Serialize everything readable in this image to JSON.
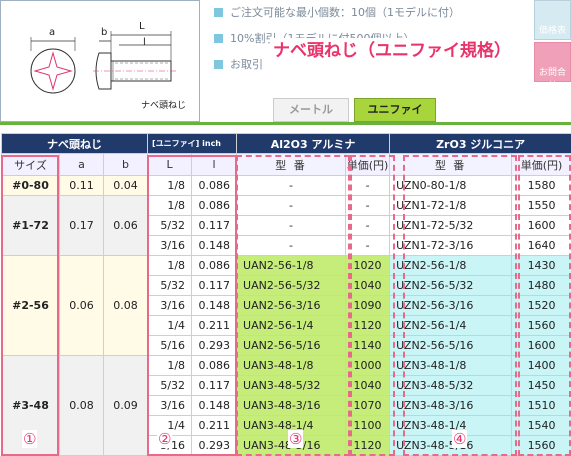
{
  "diagram": {
    "dim_a": "a",
    "dim_b": "b",
    "dim_L": "L",
    "dim_l": "l",
    "caption": "ナベ頭ねじ"
  },
  "info": {
    "item1": "ご注文可能な最小個数：10個（1モデルに付）",
    "item2": "10%割引（1モデルに付500個以上）",
    "item3": "お取引",
    "overlay": "ナベ頭ねじ（ユニファイ規格）"
  },
  "side_buttons": {
    "btn1": "価格表",
    "btn2": "お問合せ"
  },
  "tabs": {
    "metric": "メートル",
    "unify": "ユニファイ"
  },
  "table": {
    "header_left": "ナベ頭ねじ",
    "header_unit": "[ユニファイ] inch",
    "header_alumina": "Al2O3 アルミナ",
    "header_zirconia": "ZrO3 ジルコニア",
    "col_size": "サイズ",
    "col_a": "a",
    "col_b": "b",
    "col_L": "L",
    "col_l": "l",
    "col_model": "型 番",
    "col_price": "単価(円)",
    "col_model2": "型 番",
    "col_price2": "単価(円)"
  },
  "groups": [
    {
      "size": "#0-80",
      "a": "0.11",
      "b": "0.04",
      "rows": [
        {
          "L": "1/8",
          "l": "0.086",
          "al": "-",
          "alp": "-",
          "zr": "UZN0-80-1/8",
          "zrp": "1580"
        }
      ]
    },
    {
      "size": "#1-72",
      "a": "0.17",
      "b": "0.06",
      "rows": [
        {
          "L": "1/8",
          "l": "0.086",
          "al": "-",
          "alp": "-",
          "zr": "UZN1-72-1/8",
          "zrp": "1550"
        },
        {
          "L": "5/32",
          "l": "0.117",
          "al": "-",
          "alp": "-",
          "zr": "UZN1-72-5/32",
          "zrp": "1600"
        },
        {
          "L": "3/16",
          "l": "0.148",
          "al": "-",
          "alp": "-",
          "zr": "UZN1-72-3/16",
          "zrp": "1640"
        }
      ]
    },
    {
      "size": "#2-56",
      "a": "0.06",
      "b": "0.08",
      "rows": [
        {
          "L": "1/8",
          "l": "0.086",
          "al": "UAN2-56-1/8",
          "alp": "1020",
          "zr": "UZN2-56-1/8",
          "zrp": "1430"
        },
        {
          "L": "5/32",
          "l": "0.117",
          "al": "UAN2-56-5/32",
          "alp": "1040",
          "zr": "UZN2-56-5/32",
          "zrp": "1480"
        },
        {
          "L": "3/16",
          "l": "0.148",
          "al": "UAN2-56-3/16",
          "alp": "1090",
          "zr": "UZN2-56-3/16",
          "zrp": "1520"
        },
        {
          "L": "1/4",
          "l": "0.211",
          "al": "UAN2-56-1/4",
          "alp": "1120",
          "zr": "UZN2-56-1/4",
          "zrp": "1560"
        },
        {
          "L": "5/16",
          "l": "0.293",
          "al": "UAN2-56-5/16",
          "alp": "1140",
          "zr": "UZN2-56-5/16",
          "zrp": "1600"
        }
      ]
    },
    {
      "size": "#3-48",
      "a": "0.08",
      "b": "0.09",
      "rows": [
        {
          "L": "1/8",
          "l": "0.086",
          "al": "UAN3-48-1/8",
          "alp": "1000",
          "zr": "UZN3-48-1/8",
          "zrp": "1400"
        },
        {
          "L": "5/32",
          "l": "0.117",
          "al": "UAN3-48-5/32",
          "alp": "1040",
          "zr": "UZN3-48-5/32",
          "zrp": "1450"
        },
        {
          "L": "3/16",
          "l": "0.148",
          "al": "UAN3-48-3/16",
          "alp": "1070",
          "zr": "UZN3-48-3/16",
          "zrp": "1510"
        },
        {
          "L": "1/4",
          "l": "0.211",
          "al": "UAN3-48-1/4",
          "alp": "1100",
          "zr": "UZN3-48-1/4",
          "zrp": "1540"
        },
        {
          "L": "5/16",
          "l": "0.293",
          "al": "UAN3-48-5/16",
          "alp": "1120",
          "zr": "UZN3-48-5/16",
          "zrp": "1560"
        }
      ]
    }
  ],
  "callouts": {
    "c1": "①",
    "c2": "②",
    "c3": "③",
    "c4": "④"
  },
  "colors": {
    "header_navy": "#1f3a6b",
    "alumina_highlight": "#c6ec7a",
    "zirconia_highlight": "#c9f5f7",
    "callout_pink": "#e76a8a",
    "tab_green": "#a8d43c"
  }
}
